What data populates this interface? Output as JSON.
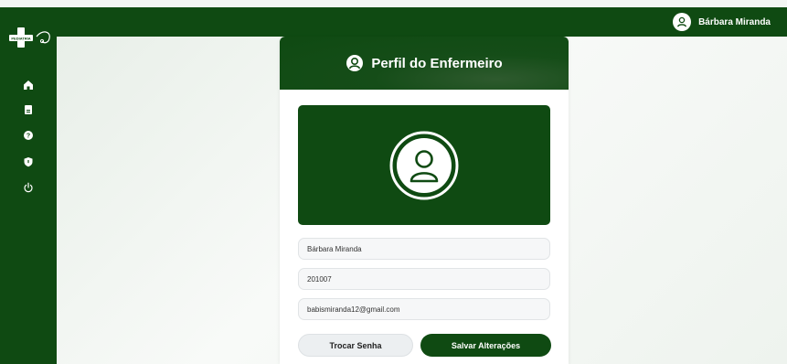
{
  "app": {
    "logo_text": "PEDIATRIA+"
  },
  "header": {
    "user_name": "Bárbara Miranda",
    "user_icon": "user-circle-icon"
  },
  "sidebar": {
    "items": [
      {
        "name": "home",
        "icon": "home-icon"
      },
      {
        "name": "records",
        "icon": "clipboard-icon"
      },
      {
        "name": "help",
        "icon": "help-circle-icon"
      },
      {
        "name": "security",
        "icon": "shield-icon"
      },
      {
        "name": "logout",
        "icon": "power-icon"
      }
    ]
  },
  "profile": {
    "title": "Perfil do Enfermeiro",
    "title_icon": "user-circle-icon",
    "photo_icon": "user-circle-icon",
    "fields": {
      "name": "Bárbara Miranda",
      "id": "201007",
      "email": "babismiranda12@gmail.com"
    },
    "change_password_label": "Trocar Senha",
    "save_label": "Salvar Alterações"
  },
  "colors": {
    "brand_green": "#0f4a12",
    "background": "#f3f6f3"
  }
}
